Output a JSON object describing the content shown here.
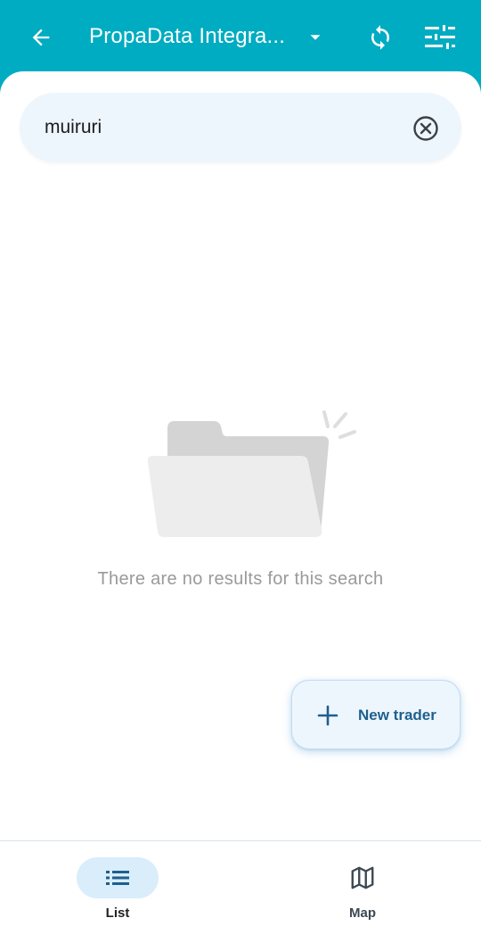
{
  "header": {
    "title": "PropaData Integra...",
    "back_icon": "arrow-left-icon",
    "dropdown_icon": "caret-down-icon",
    "sync_icon": "sync-icon",
    "filter_icon": "filter-list-icon"
  },
  "search": {
    "value": "muiruri",
    "clear_icon": "clear-circle-icon"
  },
  "empty_state": {
    "illustration": "empty-folder-icon",
    "message": "There are no results for this search"
  },
  "fab": {
    "icon": "plus-icon",
    "label": "New trader"
  },
  "bottom_nav": {
    "items": [
      {
        "label": "List",
        "icon": "list-icon",
        "active": true
      },
      {
        "label": "Map",
        "icon": "map-icon",
        "active": false
      }
    ]
  },
  "colors": {
    "primary": "#00acc1",
    "search_bg": "#eef6fd",
    "accent_text": "#1e5f8e",
    "nav_active_pill": "#d9edfb"
  }
}
